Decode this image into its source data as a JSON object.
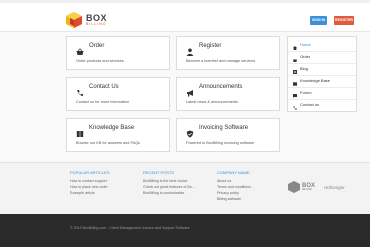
{
  "header": {
    "logo_text": "BOX",
    "logo_sub": "BILLING",
    "signin_label": "SIGN IN",
    "register_label": "REGISTER"
  },
  "cards": [
    {
      "title": "Order",
      "desc": "Order products and services",
      "icon": "basket-icon"
    },
    {
      "title": "Register",
      "desc": "Become a member and manage services",
      "icon": "user-icon"
    },
    {
      "title": "Contact Us",
      "desc": "Contact us for more information",
      "icon": "phone-icon"
    },
    {
      "title": "Announcements",
      "desc": "Latest news & announcements",
      "icon": "megaphone-icon"
    },
    {
      "title": "Knowledge Base",
      "desc": "Browse our KB for answers and FAQs",
      "icon": "book-icon"
    },
    {
      "title": "Invoicing Software",
      "desc": "Powered to BoxBilling invoicing software",
      "icon": "shield-icon"
    }
  ],
  "sidebar": {
    "items": [
      {
        "label": "Home",
        "icon": "home-icon"
      },
      {
        "label": "Order",
        "icon": "basket-icon"
      },
      {
        "label": "Blog",
        "icon": "blog-icon"
      },
      {
        "label": "Knowledge Base",
        "icon": "book-icon"
      },
      {
        "label": "Forum",
        "icon": "forum-icon"
      },
      {
        "label": "Contact us",
        "icon": "phone-icon"
      }
    ]
  },
  "footer": {
    "popular": {
      "heading": "POPULAR ARTICLES",
      "links": [
        "How to contact support",
        "How to place new order",
        "Example article"
      ]
    },
    "recent": {
      "heading": "RECENT POSTS",
      "links": [
        "BoxBilling is the best choice",
        "Check out great features of Bo...",
        "BoxBilling is customizable"
      ]
    },
    "company": {
      "heading": "COMPANY NAME",
      "links": [
        "About us",
        "Terms and conditions",
        "Privacy policy",
        "Billing software"
      ]
    },
    "logo_text": "BOX",
    "logo_sub": "BILLING",
    "partner_text": "Hofcenger"
  },
  "bottom": {
    "copyright": "© 2013 BoxBilling.com - Client Management, Invoice and Support Software"
  },
  "colors": {
    "accent_blue": "#3c8fd8",
    "accent_red": "#e05a3c",
    "footer_dark": "#2b2b2b"
  }
}
